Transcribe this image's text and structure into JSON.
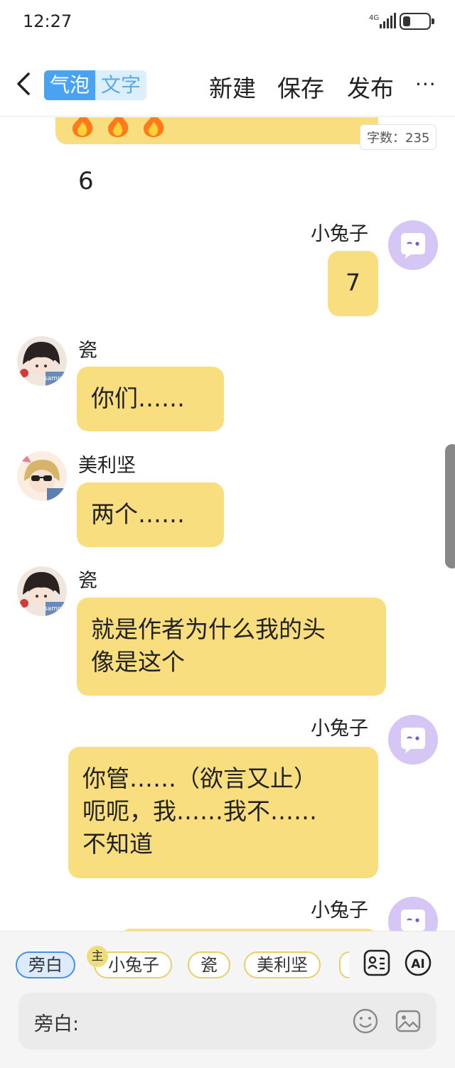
{
  "status_bar": {
    "time": "12:27",
    "network": "4G"
  },
  "header": {
    "toggle": {
      "active": "气泡",
      "inactive": "文字"
    },
    "actions": [
      "新建",
      "保存",
      "发布"
    ],
    "more": "···"
  },
  "chat": {
    "char_count": "字数：235",
    "plain_line": "6",
    "messages": [
      {
        "speaker": "小兔子",
        "text": "7"
      },
      {
        "speaker": "瓷",
        "text": "你们……"
      },
      {
        "speaker": "美利坚",
        "text": "两个……"
      },
      {
        "speaker": "瓷",
        "text_lines": [
          "就是作者为什么我的头",
          "像是这个"
        ]
      },
      {
        "speaker": "小兔子",
        "text_lines": [
          "你管……（欲言又止）",
          "呃呃，我……我不……",
          "不知道"
        ]
      },
      {
        "speaker": "小兔子",
        "text": ""
      }
    ],
    "avatar_watermark": "sample"
  },
  "bottom_bar": {
    "characters": [
      "旁白",
      "小兔子",
      "瓷",
      "美利坚"
    ],
    "owner_badge": "主",
    "ai_label": "AI",
    "input_label": "旁白:"
  },
  "colors": {
    "bubble": "#f8de7e",
    "accent": "#4aa3f0",
    "bot_avatar": "#d6c6f5"
  }
}
